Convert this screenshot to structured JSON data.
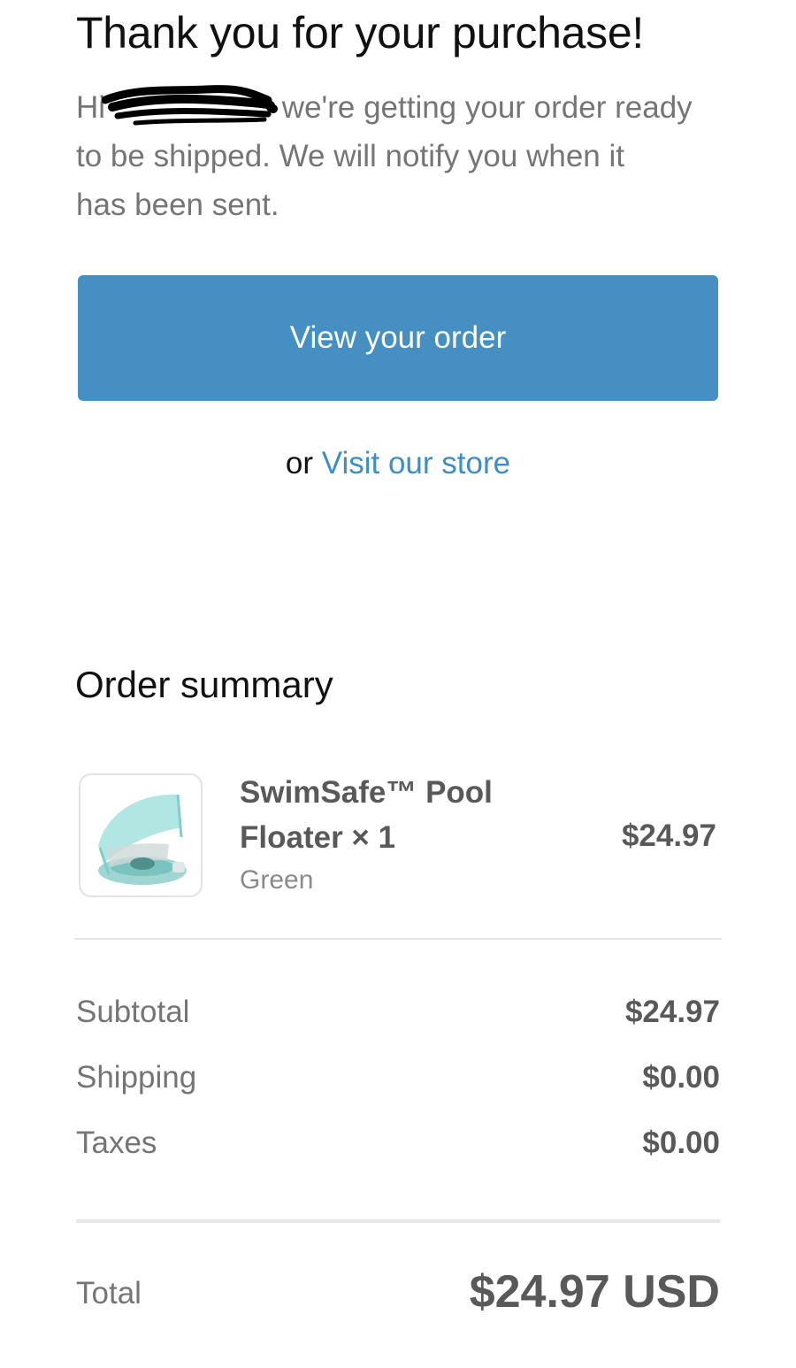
{
  "header": {
    "title": "Thank you for your purchase!",
    "greeting_prefix": "Hi",
    "message_part1": "we're getting your order ready",
    "message_part2": "to be shipped. We will notify you when it",
    "message_part3": "has been sent."
  },
  "actions": {
    "view_order_label": "View your order",
    "or_text": "or",
    "visit_store_label": "Visit our store"
  },
  "summary": {
    "title": "Order summary",
    "items": [
      {
        "name_line1": "SwimSafe™ Pool",
        "name_line2": "Floater × 1",
        "variant": "Green",
        "price": "$24.97",
        "image_icon": "pool-floater-image"
      }
    ],
    "subtotal_label": "Subtotal",
    "subtotal_value": "$24.97",
    "shipping_label": "Shipping",
    "shipping_value": "$0.00",
    "taxes_label": "Taxes",
    "taxes_value": "$0.00",
    "total_label": "Total",
    "total_value": "$24.97 USD"
  },
  "colors": {
    "button": "#458fc2",
    "link": "#3d8ec6",
    "muted_text": "#757575",
    "strong_text": "#595959"
  }
}
